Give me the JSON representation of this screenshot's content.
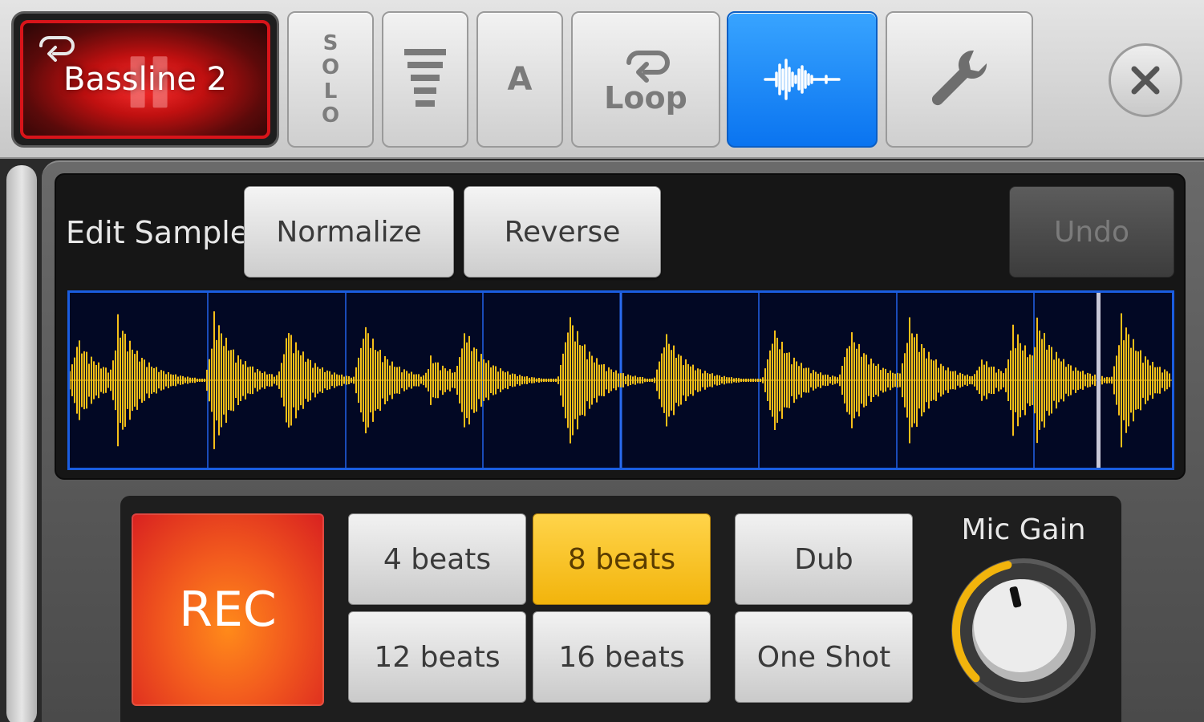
{
  "toolbar": {
    "track_name": "Bassline 2",
    "solo_letters": [
      "S",
      "O",
      "L",
      "O"
    ],
    "a_label": "A",
    "loop_label": "Loop",
    "icons": {
      "track_loop": "loop-icon",
      "eq": "equalizer-icon",
      "loop": "loop-icon",
      "waveform": "waveform-icon",
      "wrench": "wrench-icon",
      "close": "close-icon"
    },
    "active_color": "#1a86f8",
    "track_color": "#e01818"
  },
  "edit": {
    "label": "Edit Sample",
    "normalize": "Normalize",
    "reverse": "Reverse",
    "undo": "Undo"
  },
  "waveform": {
    "wave_color": "#f5c018",
    "border_color": "#1a5de0",
    "divisions": 8
  },
  "record": {
    "rec_label": "REC",
    "beats": [
      "4 beats",
      "8 beats",
      "12 beats",
      "16 beats"
    ],
    "selected_beats": "8 beats",
    "dub": "Dub",
    "one_shot": "One Shot",
    "mic_gain_label": "Mic Gain",
    "mic_gain_level": 0.45,
    "accent_color": "#f2b40c"
  }
}
